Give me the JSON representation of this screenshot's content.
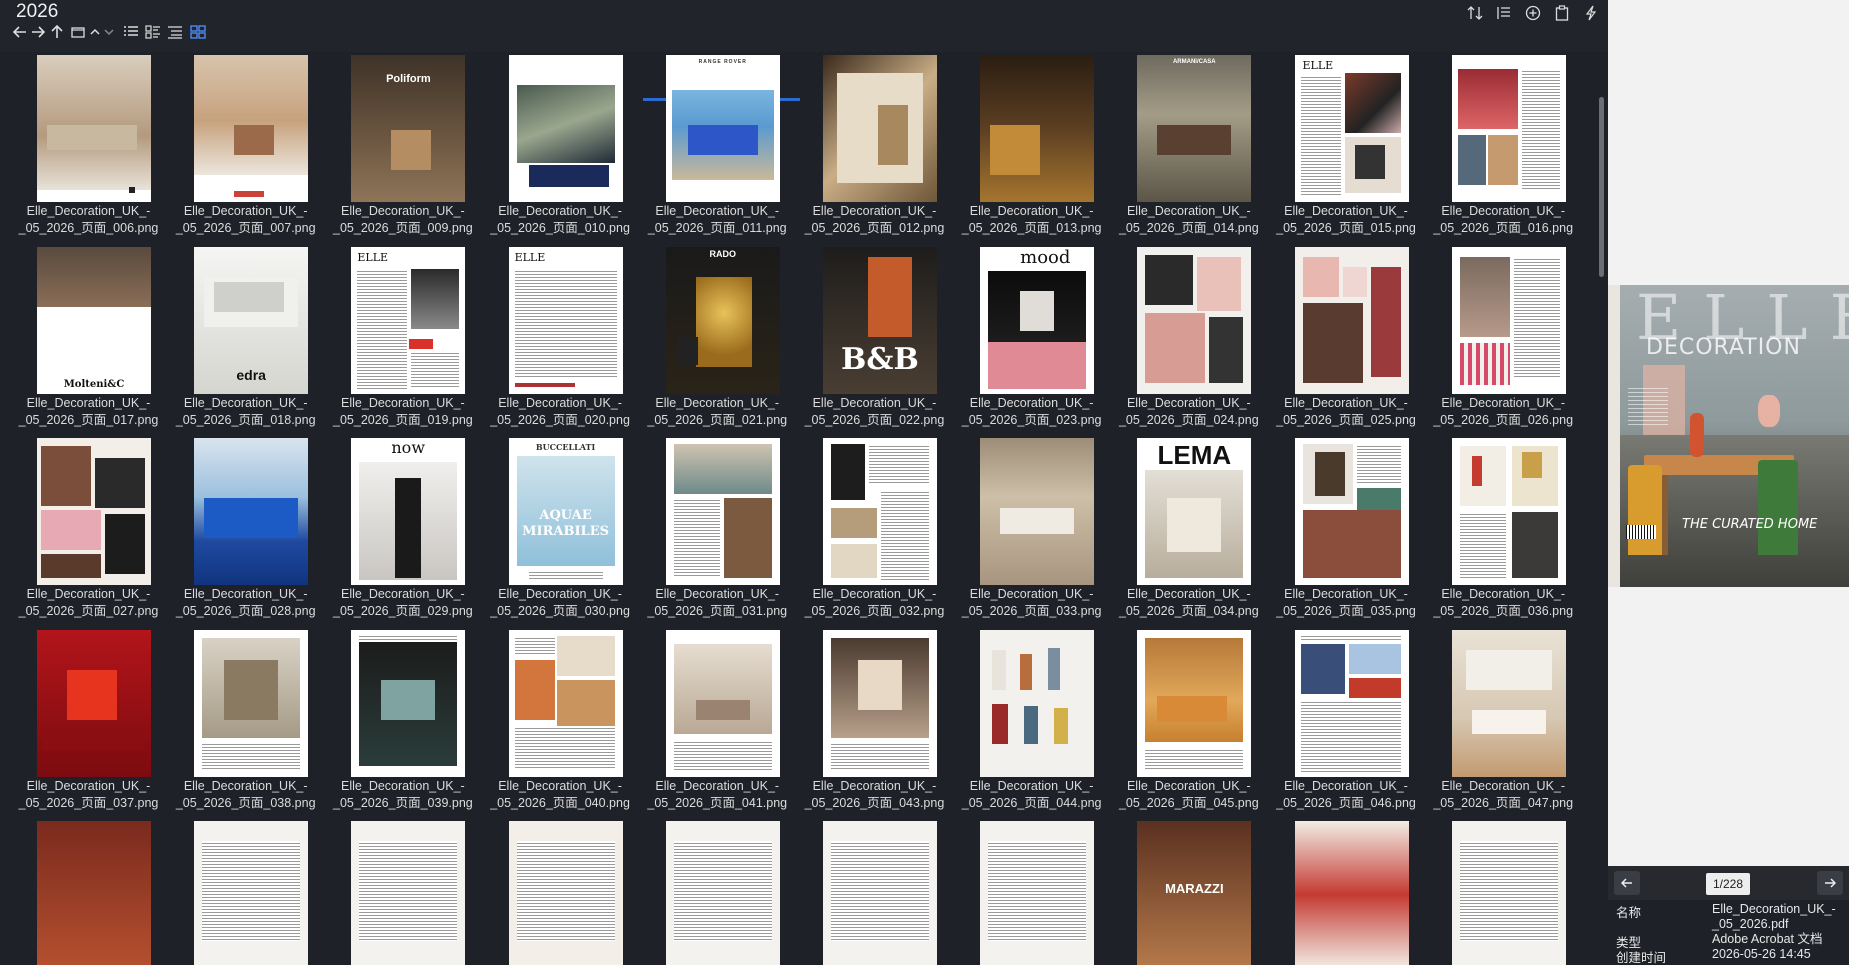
{
  "window": {
    "title": "2026"
  },
  "toolbar": {
    "nav": [
      "back-icon",
      "forward-icon",
      "up-icon",
      "folder-icon",
      "sort-up-icon",
      "sort-down-icon"
    ],
    "views": [
      "details-view-icon",
      "tiles-view-icon",
      "list-view-icon",
      "grid-view-icon"
    ],
    "right": [
      "sort-icon",
      "columns-icon",
      "add-icon",
      "clipboard-icon",
      "lightning-icon"
    ]
  },
  "files": [
    {
      "line1": "Elle_Decoration_UK_-",
      "line2": "_05_2026_页面_006.png"
    },
    {
      "line1": "Elle_Decoration_UK_-",
      "line2": "_05_2026_页面_007.png"
    },
    {
      "line1": "Elle_Decoration_UK_-",
      "line2": "_05_2026_页面_009.png"
    },
    {
      "line1": "Elle_Decoration_UK_-",
      "line2": "_05_2026_页面_010.png"
    },
    {
      "line1": "Elle_Decoration_UK_-",
      "line2": "_05_2026_页面_011.png"
    },
    {
      "line1": "Elle_Decoration_UK_-",
      "line2": "_05_2026_页面_012.png"
    },
    {
      "line1": "Elle_Decoration_UK_-",
      "line2": "_05_2026_页面_013.png"
    },
    {
      "line1": "Elle_Decoration_UK_-",
      "line2": "_05_2026_页面_014.png"
    },
    {
      "line1": "Elle_Decoration_UK_-",
      "line2": "_05_2026_页面_015.png"
    },
    {
      "line1": "Elle_Decoration_UK_-",
      "line2": "_05_2026_页面_016.png"
    },
    {
      "line1": "Elle_Decoration_UK_-",
      "line2": "_05_2026_页面_017.png"
    },
    {
      "line1": "Elle_Decoration_UK_-",
      "line2": "_05_2026_页面_018.png"
    },
    {
      "line1": "Elle_Decoration_UK_-",
      "line2": "_05_2026_页面_019.png"
    },
    {
      "line1": "Elle_Decoration_UK_-",
      "line2": "_05_2026_页面_020.png"
    },
    {
      "line1": "Elle_Decoration_UK_-",
      "line2": "_05_2026_页面_021.png"
    },
    {
      "line1": "Elle_Decoration_UK_-",
      "line2": "_05_2026_页面_022.png"
    },
    {
      "line1": "Elle_Decoration_UK_-",
      "line2": "_05_2026_页面_023.png"
    },
    {
      "line1": "Elle_Decoration_UK_-",
      "line2": "_05_2026_页面_024.png"
    },
    {
      "line1": "Elle_Decoration_UK_-",
      "line2": "_05_2026_页面_025.png"
    },
    {
      "line1": "Elle_Decoration_UK_-",
      "line2": "_05_2026_页面_026.png"
    },
    {
      "line1": "Elle_Decoration_UK_-",
      "line2": "_05_2026_页面_027.png"
    },
    {
      "line1": "Elle_Decoration_UK_-",
      "line2": "_05_2026_页面_028.png"
    },
    {
      "line1": "Elle_Decoration_UK_-",
      "line2": "_05_2026_页面_029.png"
    },
    {
      "line1": "Elle_Decoration_UK_-",
      "line2": "_05_2026_页面_030.png"
    },
    {
      "line1": "Elle_Decoration_UK_-",
      "line2": "_05_2026_页面_031.png"
    },
    {
      "line1": "Elle_Decoration_UK_-",
      "line2": "_05_2026_页面_032.png"
    },
    {
      "line1": "Elle_Decoration_UK_-",
      "line2": "_05_2026_页面_033.png"
    },
    {
      "line1": "Elle_Decoration_UK_-",
      "line2": "_05_2026_页面_034.png"
    },
    {
      "line1": "Elle_Decoration_UK_-",
      "line2": "_05_2026_页面_035.png"
    },
    {
      "line1": "Elle_Decoration_UK_-",
      "line2": "_05_2026_页面_036.png"
    },
    {
      "line1": "Elle_Decoration_UK_-",
      "line2": "_05_2026_页面_037.png"
    },
    {
      "line1": "Elle_Decoration_UK_-",
      "line2": "_05_2026_页面_038.png"
    },
    {
      "line1": "Elle_Decoration_UK_-",
      "line2": "_05_2026_页面_039.png"
    },
    {
      "line1": "Elle_Decoration_UK_-",
      "line2": "_05_2026_页面_040.png"
    },
    {
      "line1": "Elle_Decoration_UK_-",
      "line2": "_05_2026_页面_041.png"
    },
    {
      "line1": "Elle_Decoration_UK_-",
      "line2": "_05_2026_页面_043.png"
    },
    {
      "line1": "Elle_Decoration_UK_-",
      "line2": "_05_2026_页面_044.png"
    },
    {
      "line1": "Elle_Decoration_UK_-",
      "line2": "_05_2026_页面_045.png"
    },
    {
      "line1": "Elle_Decoration_UK_-",
      "line2": "_05_2026_页面_046.png"
    },
    {
      "line1": "Elle_Decoration_UK_-",
      "line2": "_05_2026_页面_047.png"
    }
  ],
  "thumb_text": {
    "poliform": "Poliform",
    "range_rover": "RANGE ROVER",
    "armani_casa": "ARMANI/CASA",
    "elle": "ELLE",
    "molteni": "Molteni&C",
    "edra": "edra",
    "rado": "RADO",
    "bb": "B&B",
    "mood": "mood",
    "now": "now",
    "buccellati": "BUCCELLATI",
    "aquae": "AQUAE MIRABILES",
    "lema": "LEMA",
    "marazzi": "MARAZZI"
  },
  "preview": {
    "cover_masthead": "ELLE",
    "cover_sub": "DECORATION",
    "cover_tagline": "THE CURATED HOME",
    "page_indicator": "1/228",
    "info": [
      {
        "key": "名称",
        "value": "Elle_Decoration_UK_-_05_2026.pdf"
      },
      {
        "key": "类型",
        "value": "Adobe Acrobat 文档"
      },
      {
        "key": "创建时间",
        "value": "2026-05-26 14:45"
      }
    ]
  },
  "colors": {
    "background": "#1f2128",
    "accent": "#2c6bd1",
    "text": "#dcdcdc"
  }
}
